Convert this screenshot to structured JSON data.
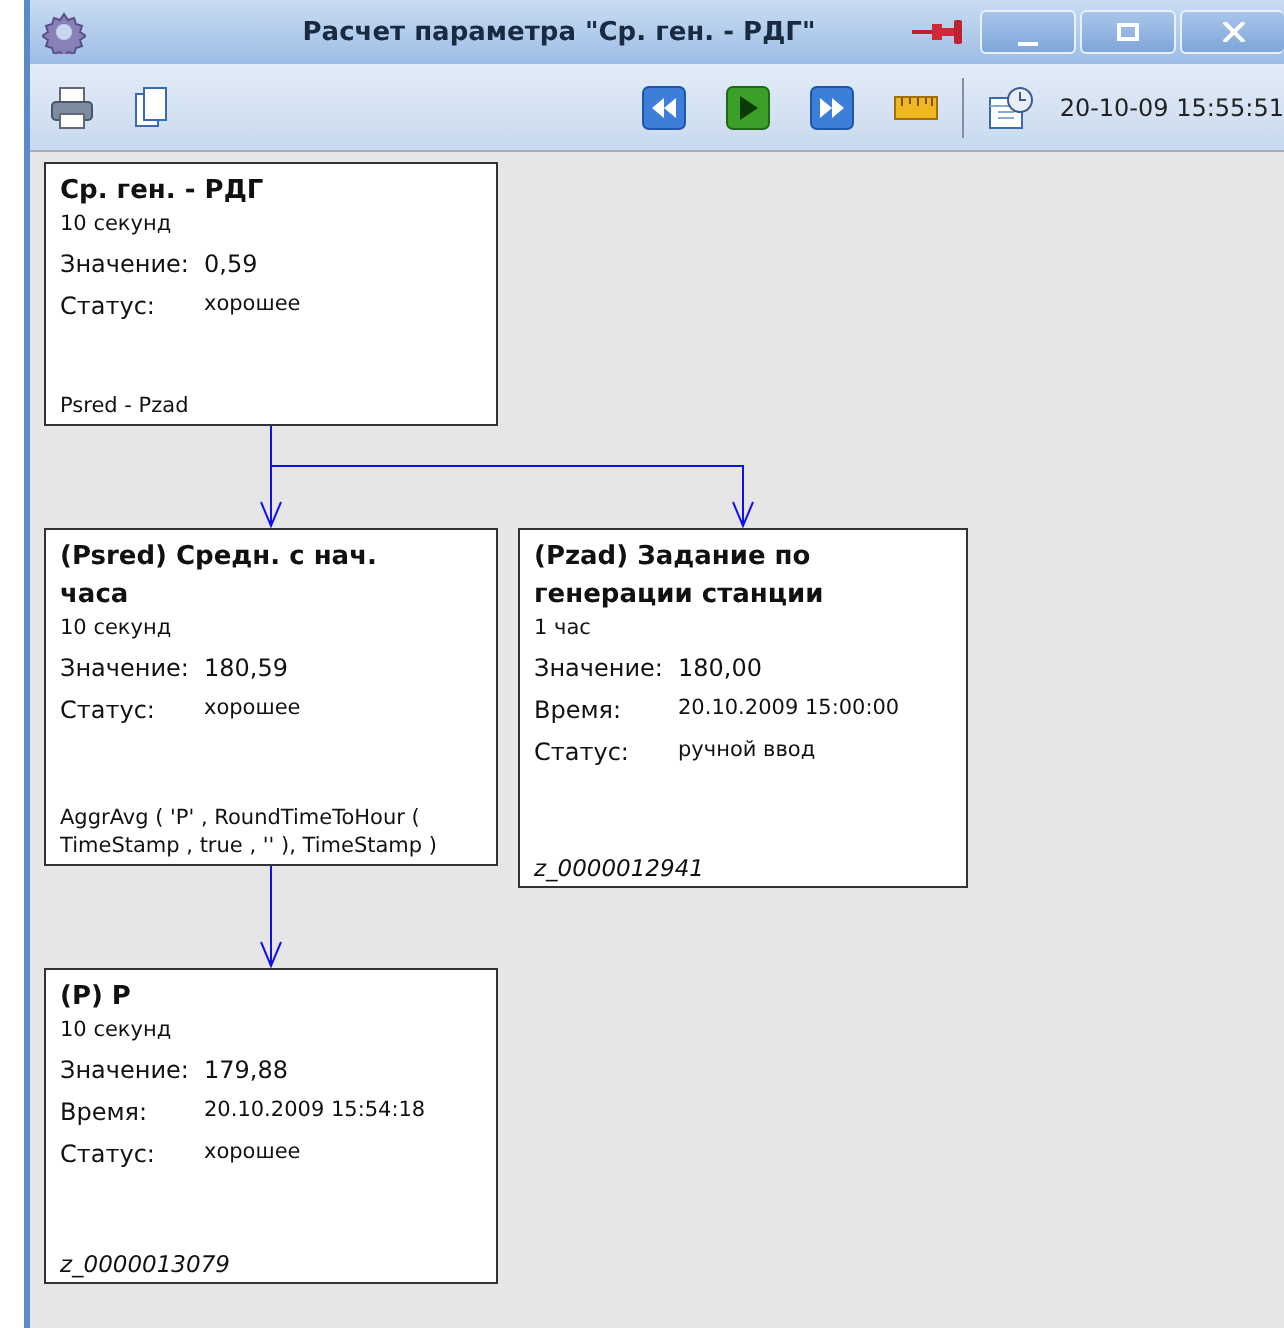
{
  "window": {
    "title": "Расчет параметра \"Ср. ген. - РДГ\""
  },
  "toolbar": {
    "datetime": "20-10-09 15:55:51"
  },
  "tree": {
    "title": "Ср. ген. - РДГ",
    "period": "10 секунд",
    "rows": [
      {
        "label": "Значение:",
        "value": "0,59",
        "kind": "main"
      },
      {
        "label": "Статус:",
        "value": "хорошее",
        "kind": "small"
      }
    ],
    "note": {
      "kind": "formula",
      "text": "Psred - Pzad"
    },
    "children": [
      {
        "title": "(Psred) Средн. с нач. часа",
        "period": "10 секунд",
        "rows": [
          {
            "label": "Значение:",
            "value": "180,59",
            "kind": "main"
          },
          {
            "label": "Статус:",
            "value": "хорошее",
            "kind": "small"
          }
        ],
        "note": {
          "kind": "formula",
          "text": "AggrAvg ( 'P' , RoundTimeToHour ( TimeStamp , true , '' ), TimeStamp )"
        },
        "children": [
          {
            "title": "(P) P",
            "period": "10 секунд",
            "rows": [
              {
                "label": "Значение:",
                "value": "179,88",
                "kind": "main"
              },
              {
                "label": "Время:",
                "value": "20.10.2009 15:54:18",
                "kind": "small"
              },
              {
                "label": "Статус:",
                "value": "хорошее",
                "kind": "small"
              }
            ],
            "note": {
              "kind": "id",
              "text": "z_0000013079"
            }
          }
        ]
      },
      {
        "title": "(Pzad) Задание по генерации станции",
        "period": "1 час",
        "rows": [
          {
            "label": "Значение:",
            "value": "180,00",
            "kind": "main"
          },
          {
            "label": "Время:",
            "value": "20.10.2009 15:00:00",
            "kind": "small"
          },
          {
            "label": "Статус:",
            "value": "ручной ввод",
            "kind": "small"
          }
        ],
        "note": {
          "kind": "id",
          "text": "z_0000012941"
        }
      }
    ]
  }
}
